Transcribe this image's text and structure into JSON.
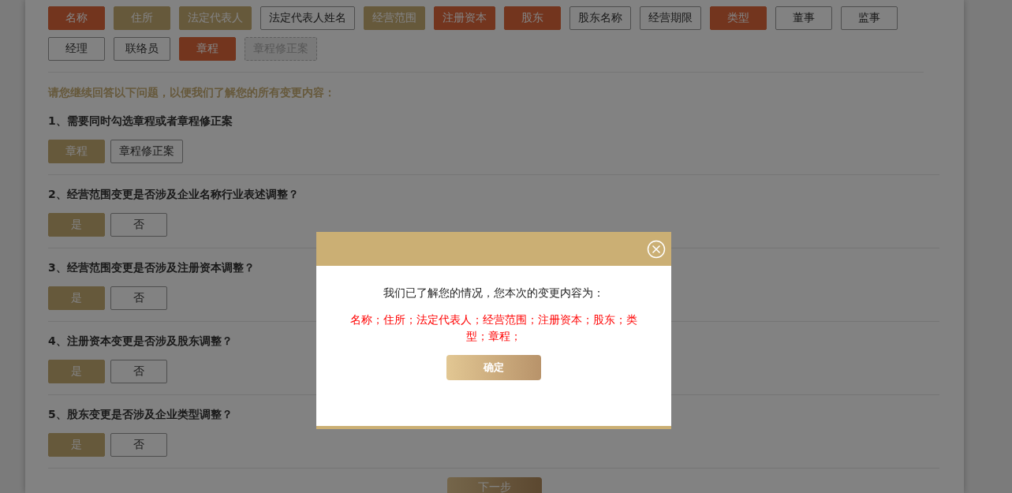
{
  "change_tags": [
    {
      "label": "名称",
      "kind": "changed"
    },
    {
      "label": "住所",
      "kind": "selected"
    },
    {
      "label": "法定代表人",
      "kind": "selected"
    },
    {
      "label": "法定代表人姓名",
      "kind": "plain"
    },
    {
      "label": "经营范围",
      "kind": "selected"
    },
    {
      "label": "注册资本",
      "kind": "changed"
    },
    {
      "label": "股东",
      "kind": "changed"
    },
    {
      "label": "股东名称",
      "kind": "plain"
    },
    {
      "label": "经营期限",
      "kind": "plain"
    },
    {
      "label": "类型",
      "kind": "changed"
    },
    {
      "label": "董事",
      "kind": "plain"
    },
    {
      "label": "监事",
      "kind": "plain"
    },
    {
      "label": "经理",
      "kind": "plain"
    },
    {
      "label": "联络员",
      "kind": "plain"
    },
    {
      "label": "章程",
      "kind": "changed"
    },
    {
      "label": "章程修正案",
      "kind": "disabled"
    }
  ],
  "intro": "请您继续回答以下问题，以便我们了解您的所有变更内容：",
  "questions": [
    {
      "text": "1、需要同时勾选章程或者章程修正案",
      "options": [
        {
          "label": "章程",
          "selected": true
        },
        {
          "label": "章程修正案",
          "selected": false
        }
      ]
    },
    {
      "text": "2、经营范围变更是否涉及企业名称行业表述调整？",
      "options": [
        {
          "label": "是",
          "selected": true
        },
        {
          "label": "否",
          "selected": false
        }
      ]
    },
    {
      "text": "3、经营范围变更是否涉及注册资本调整？",
      "options": [
        {
          "label": "是",
          "selected": true
        },
        {
          "label": "否",
          "selected": false
        }
      ]
    },
    {
      "text": "4、注册资本变更是否涉及股东调整？",
      "options": [
        {
          "label": "是",
          "selected": true
        },
        {
          "label": "否",
          "selected": false
        }
      ]
    },
    {
      "text": "5、股东变更是否涉及企业类型调整？",
      "options": [
        {
          "label": "是",
          "selected": true
        },
        {
          "label": "否",
          "selected": false
        }
      ]
    }
  ],
  "next_button": "下一步",
  "dialog": {
    "message": "我们已了解您的情况，您本次的变更内容为：",
    "changes": "名称；住所；法定代表人；经营范围；注册资本；股东；类型；章程；",
    "confirm_button": "确定"
  }
}
